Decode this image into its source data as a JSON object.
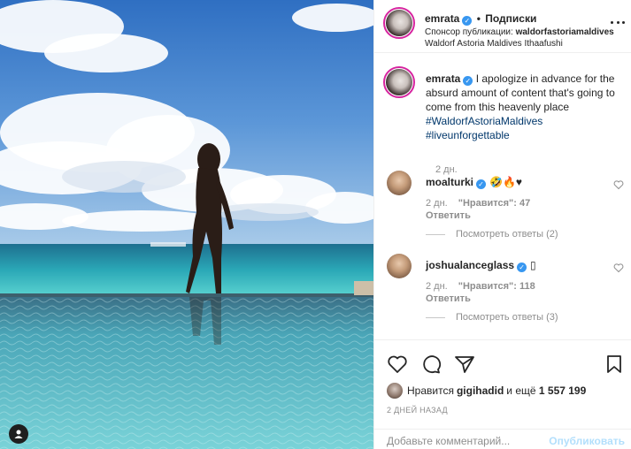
{
  "photo": {
    "alt_icon": "user-tag-icon"
  },
  "header": {
    "username": "emrata",
    "dot": "•",
    "follow_label": "Подписки",
    "sponsor_label": "Спонсор публикации:",
    "sponsor_name": "waldorfastoriamaldives",
    "location": "Waldorf Astoria Maldives Ithaafushi",
    "more_icon": "more-options-icon"
  },
  "caption": {
    "username": "emrata",
    "text": "I apologize in advance for the absurd amount of content that's going to come from this heavenly place ",
    "hashtag1": "#WaldorfAstoriaMaldives",
    "hashtag2": "#liveunforgettable",
    "time": "2 дн."
  },
  "comments": [
    {
      "username": "moalturki",
      "emoji": "🤣🔥♥",
      "time": "2 дн.",
      "likes": "\"Нравится\": 47",
      "reply": "Ответить",
      "replies": "Посмотреть ответы (2)"
    },
    {
      "username": "joshualanceglass",
      "emoji": "▯",
      "time": "2 дн.",
      "likes": "\"Нравится\": 118",
      "reply": "Ответить",
      "replies": "Посмотреть ответы (3)"
    }
  ],
  "likes": {
    "prefix": "Нравится ",
    "liker": "gigihadid",
    "middle": " и ещё ",
    "count": "1 557 199"
  },
  "post_date": "2 ДНЕЙ НАЗАД",
  "add_comment": {
    "placeholder": "Добавьте комментарий...",
    "publish_label": "Опубликовать"
  },
  "colors": {
    "verified": "#3897f0",
    "hashtag": "#00376b",
    "publish_disabled": "#b2dffc",
    "muted": "#8e8e8e"
  }
}
